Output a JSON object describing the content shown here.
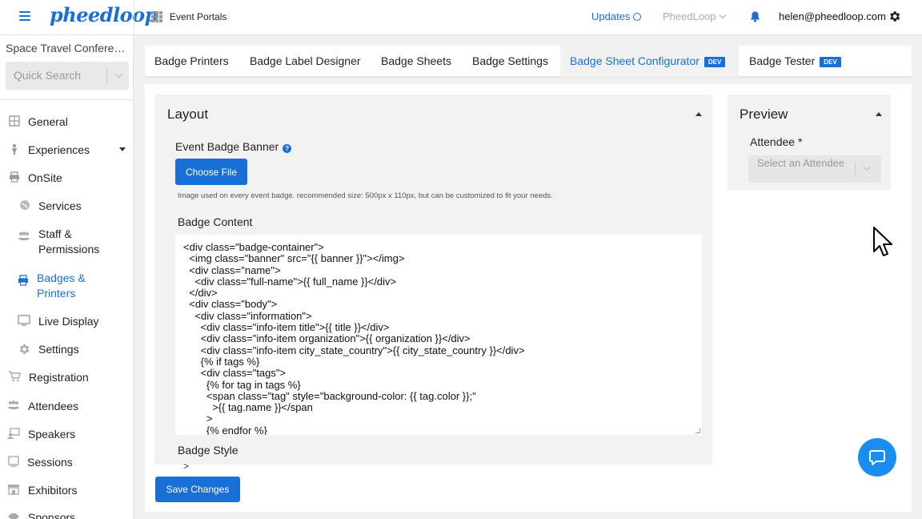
{
  "app": {
    "logo": "pheedloop"
  },
  "topbar": {
    "portals_label": "Event Portals",
    "updates_label": "Updates",
    "org_label": "PheedLoop",
    "user_email": "helen@pheedloop.com"
  },
  "sidebar": {
    "event_name": "Space Travel Conference",
    "quick_search_placeholder": "Quick Search",
    "items": [
      {
        "label": "General",
        "icon": "grid-icon"
      },
      {
        "label": "Experiences",
        "icon": "person-icon"
      },
      {
        "label": "OnSite",
        "icon": "printer-icon"
      },
      {
        "label": "Services",
        "icon": "globe-icon"
      },
      {
        "label": "Staff &\nPermissions",
        "icon": "users-icon"
      },
      {
        "label": "Badges &\nPrinters",
        "icon": "printer-icon"
      },
      {
        "label": "Live Display",
        "icon": "monitor-icon"
      },
      {
        "label": "Settings",
        "icon": "gear-icon"
      },
      {
        "label": "Registration",
        "icon": "cart-icon"
      },
      {
        "label": "Attendees",
        "icon": "users-icon"
      },
      {
        "label": "Speakers",
        "icon": "speaker-icon"
      },
      {
        "label": "Sessions",
        "icon": "screen-icon"
      },
      {
        "label": "Exhibitors",
        "icon": "store-icon"
      },
      {
        "label": "Sponsors",
        "icon": "sponsor-icon"
      }
    ]
  },
  "tabs": [
    {
      "label": "Badge Printers"
    },
    {
      "label": "Badge Label Designer"
    },
    {
      "label": "Badge Sheets"
    },
    {
      "label": "Badge Settings"
    },
    {
      "label": "Badge Sheet Configurator",
      "badge": "DEV"
    },
    {
      "label": "Badge Tester",
      "badge": "DEV"
    }
  ],
  "layout": {
    "title": "Layout",
    "banner_label": "Event Badge Banner",
    "choose_file": "Choose File",
    "banner_hint": "Image used on every event badge. recommended size: 500px x 110px, but can be customized to fit your needs.",
    "content_label": "Badge Content",
    "content_code": "<div class=\"badge-container\">\n  <img class=\"banner\" src=\"{{ banner }}\"></img>\n  <div class=\"name\">\n    <div class=\"full-name\">{{ full_name }}</div>\n  </div>\n  <div class=\"body\">\n    <div class=\"information\">\n      <div class=\"info-item title\">{{ title }}</div>\n      <div class=\"info-item organization\">{{ organization }}</div>\n      <div class=\"info-item city_state_country\">{{ city_state_country }}</div>\n      {% if tags %}\n      <div class=\"tags\">\n        {% for tag in tags %}\n        <span class=\"tag\" style=\"background-color: {{ tag.color }};\"\n          >{{ tag.name }}</span\n        >\n        {% endfor %}",
    "style_label": "Badge Style",
    "style_next_line": ">"
  },
  "preview": {
    "title": "Preview",
    "attendee_label": "Attendee *",
    "attendee_placeholder": "Select an Attendee"
  },
  "actions": {
    "save_label": "Save Changes"
  },
  "colors": {
    "accent": "#1a6fd6",
    "chat": "#1a8ef0"
  }
}
